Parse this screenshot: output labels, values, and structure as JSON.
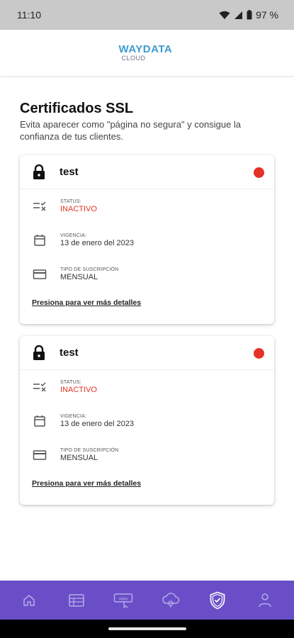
{
  "status_bar": {
    "time": "11:10",
    "battery": "97 %"
  },
  "header": {
    "logo_main": "WAYDATA",
    "logo_sub": "CLOUD"
  },
  "page": {
    "title": "Certificados SSL",
    "subtitle": "Evita aparecer como \"página no segura\" y consigue la confianza de tus clientes."
  },
  "certificates": [
    {
      "name": "test",
      "status_label": "STATUS:",
      "status_value": "INACTIVO",
      "vigencia_label": "VIGENCIA:",
      "vigencia_value": "13 de enero del 2023",
      "subscription_label": "TIPO DE SUSCRIPCIÓN",
      "subscription_value": "MENSUAL",
      "details_link": "Presiona para ver más detalles",
      "status_color": "#e53227"
    },
    {
      "name": "test",
      "status_label": "STATUS:",
      "status_value": "INACTIVO",
      "vigencia_label": "VIGENCIA:",
      "vigencia_value": "13 de enero del 2023",
      "subscription_label": "TIPO DE SUSCRIPCIÓN",
      "subscription_value": "MENSUAL",
      "details_link": "Presiona para ver más detalles",
      "status_color": "#e53227"
    }
  ],
  "bottom_nav": {
    "items": [
      "home-icon",
      "hosting-icon",
      "domain-icon",
      "cloud-icon",
      "ssl-shield-icon",
      "user-icon"
    ],
    "active": "ssl-shield-icon",
    "background": "#6a4ec7"
  }
}
